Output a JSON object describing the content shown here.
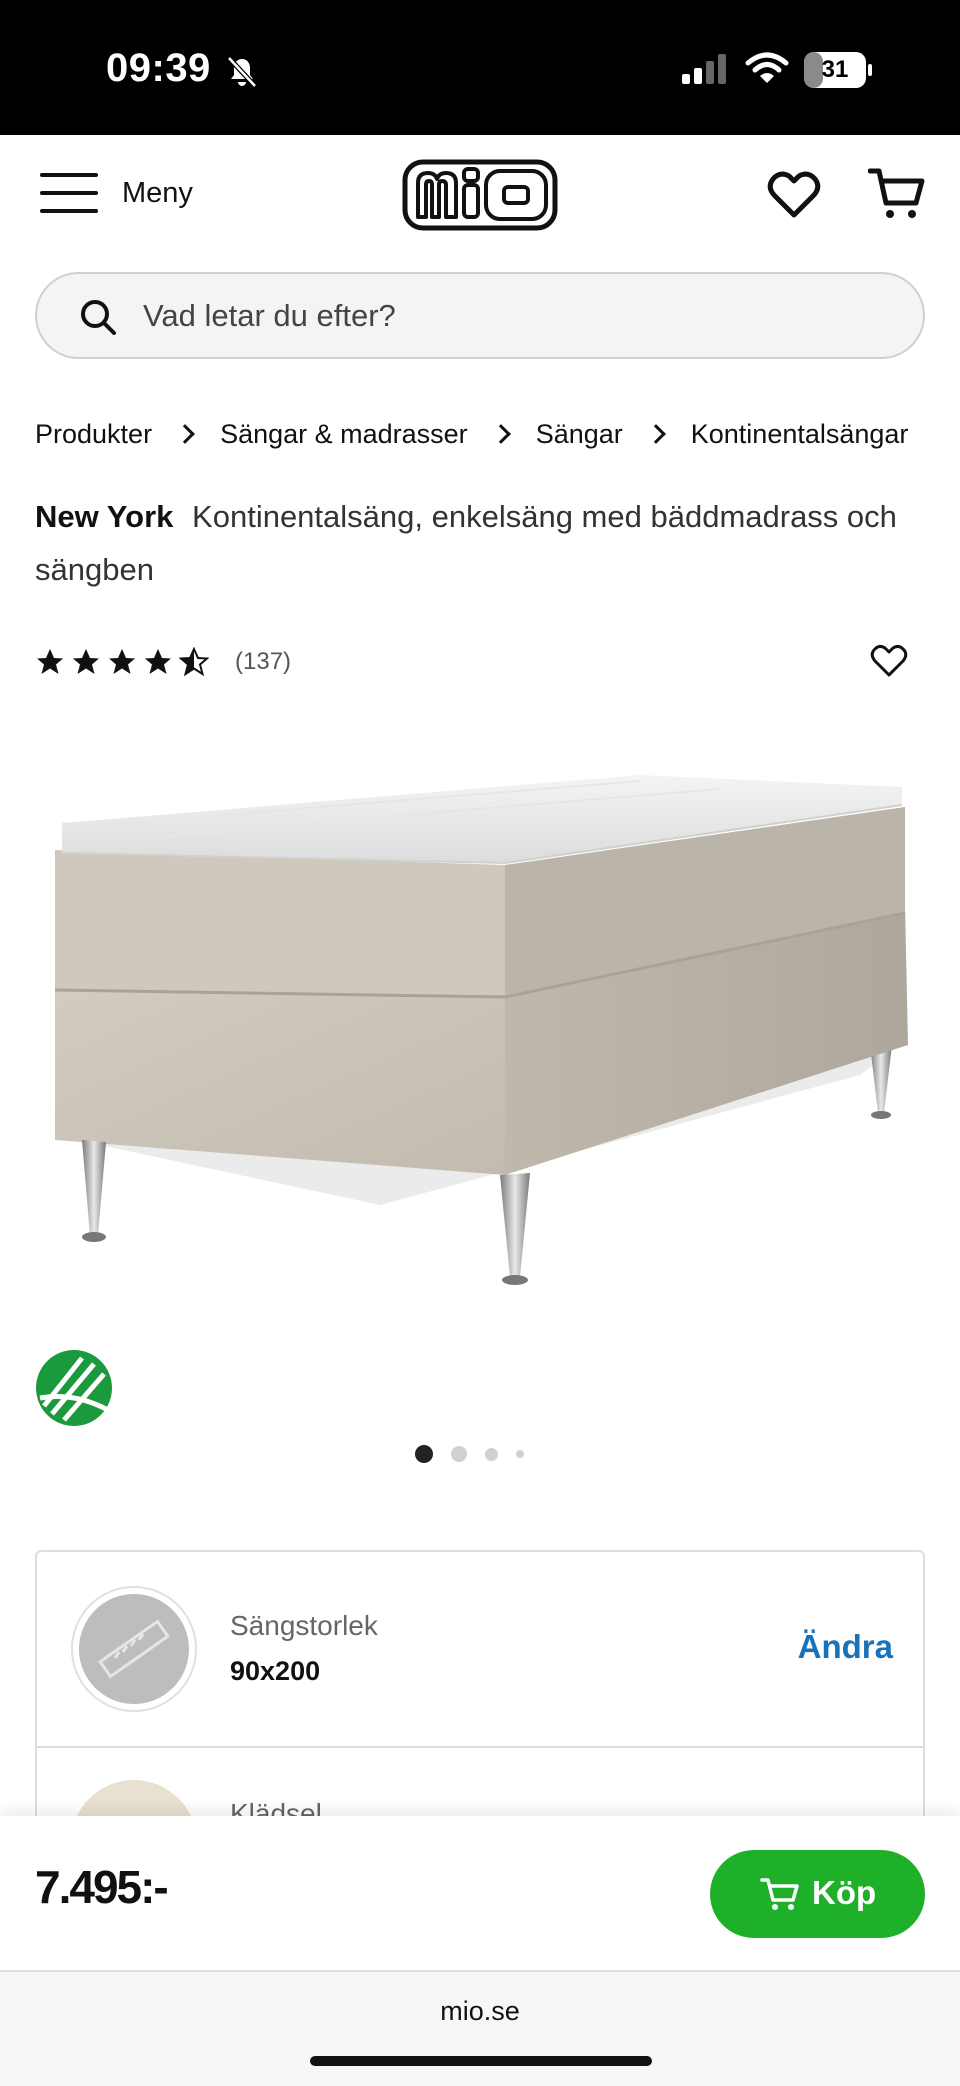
{
  "status_bar": {
    "time": "09:39",
    "battery": "31",
    "battery_level": 0.31
  },
  "header": {
    "menu_label": "Meny",
    "logo_text": "mio",
    "wishlist_icon": "heart-icon",
    "cart_icon": "cart-icon"
  },
  "search": {
    "placeholder": "Vad letar du efter?"
  },
  "breadcrumb": [
    "Produkter",
    "Sängar & madrasser",
    "Sängar",
    "Kontinentalsängar"
  ],
  "product": {
    "brand": "New York",
    "description": "Kontinentalsäng, enkelsäng med bäddmadrass och sängben",
    "rating_value": 4.5,
    "rating_max": 5,
    "review_count": "(137)",
    "image_count": 4,
    "active_image": 0
  },
  "options": [
    {
      "label": "Sängstorlek",
      "value": "90x200",
      "action": "Ändra"
    },
    {
      "label": "Klädsel"
    }
  ],
  "buy": {
    "price": "7.495:-",
    "button_label": "Köp"
  },
  "browser": {
    "url": "mio.se"
  },
  "colors": {
    "buy_green": "#1fb02a",
    "link_blue": "#1a73b8",
    "ecolabel_green": "#1a9a3c"
  }
}
